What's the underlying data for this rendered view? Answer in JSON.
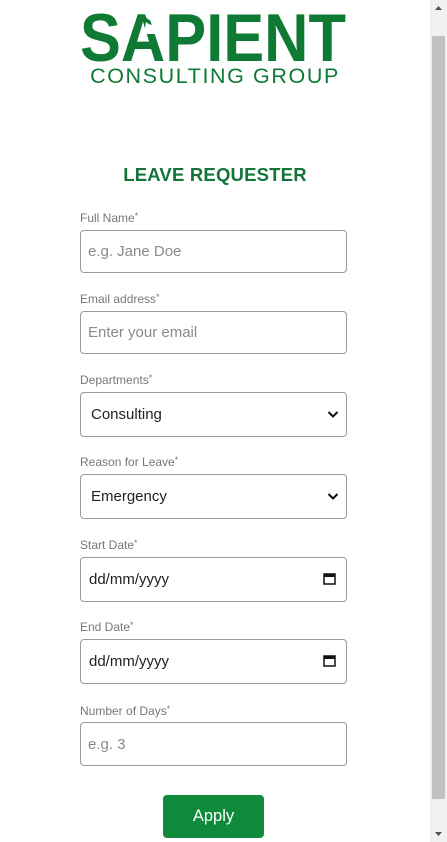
{
  "logo": {
    "brand": "SAPIENT",
    "subtitle": "CONSULTING GROUP",
    "color": "#0f7a34"
  },
  "form": {
    "title": "LEAVE REQUESTER",
    "required_mark": "*",
    "full_name": {
      "label": "Full Name",
      "placeholder": "e.g. Jane Doe",
      "value": ""
    },
    "email": {
      "label": "Email address",
      "placeholder": "Enter your email",
      "value": ""
    },
    "department": {
      "label": "Departments",
      "selected": "Consulting",
      "icon": "chevron-down-icon"
    },
    "reason": {
      "label": "Reason for Leave",
      "selected": "Emergency",
      "icon": "chevron-down-icon"
    },
    "start_date": {
      "label": "Start Date",
      "value": "dd/mm/yyyy",
      "icon": "calendar-icon"
    },
    "end_date": {
      "label": "End Date",
      "value": "dd/mm/yyyy",
      "icon": "calendar-icon"
    },
    "days": {
      "label": "Number of Days",
      "placeholder": "e.g. 3",
      "value": ""
    },
    "submit_label": "Apply"
  },
  "colors": {
    "accent": "#0e8a3a",
    "title": "#13753a",
    "label": "#777777",
    "border": "#9a9a9a"
  }
}
